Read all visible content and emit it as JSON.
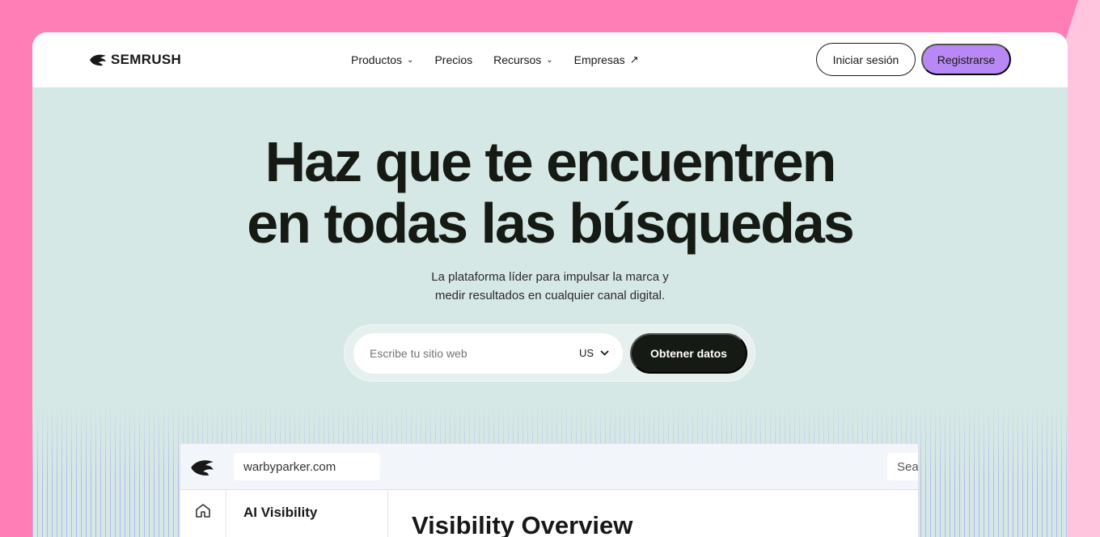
{
  "brand": {
    "name": "SEMRUSH"
  },
  "nav": {
    "items": [
      {
        "label": "Productos",
        "chevron": true
      },
      {
        "label": "Precios",
        "chevron": false
      },
      {
        "label": "Recursos",
        "chevron": true
      },
      {
        "label": "Empresas",
        "external": true
      }
    ],
    "login_label": "Iniciar sesión",
    "register_label": "Registrarse"
  },
  "hero": {
    "title_line1": "Haz que te encuentren",
    "title_line2": "en todas las búsquedas",
    "subtitle_line1": "La plataforma líder para impulsar la marca y",
    "subtitle_line2": "medir resultados en cualquier canal digital."
  },
  "search": {
    "placeholder": "Escribe tu sitio web",
    "country": "US",
    "submit_label": "Obtener datos"
  },
  "preview": {
    "domain": "warbyparker.com",
    "search_text": "Sea",
    "side_title": "AI Visibility",
    "main_title": "Visibility Overview"
  },
  "colors": {
    "background": "#ff7eb6",
    "hero": "#d6e8e6",
    "accent": "#b889f5",
    "dark": "#161a14"
  }
}
